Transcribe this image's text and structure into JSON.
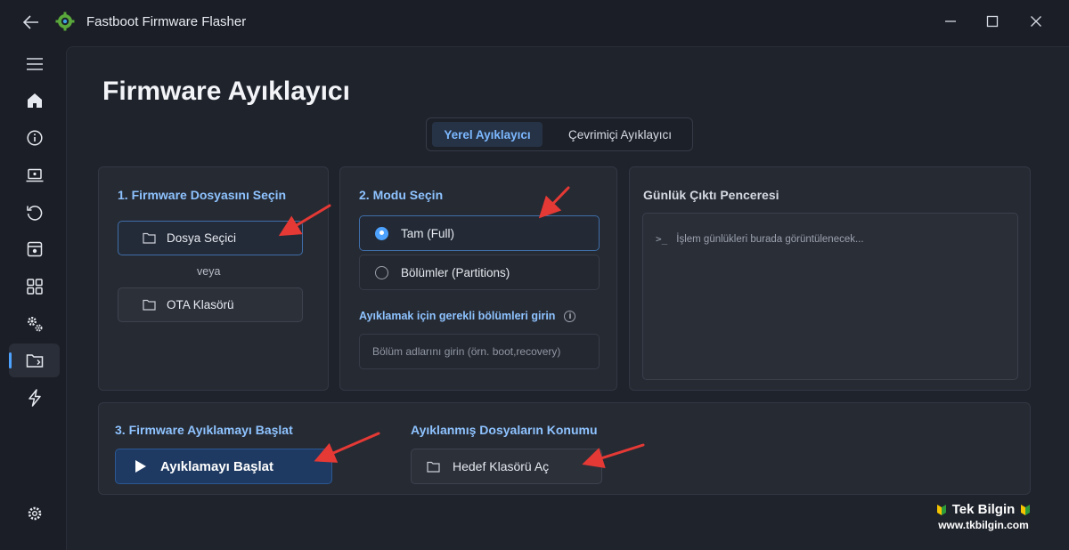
{
  "window": {
    "title": "Fastboot Firmware Flasher"
  },
  "page": {
    "title": "Firmware Ayıklayıcı",
    "tabs": [
      {
        "label": "Yerel Ayıklayıcı",
        "active": true
      },
      {
        "label": "Çevrimiçi Ayıklayıcı",
        "active": false
      }
    ]
  },
  "sidebar": {
    "items": [
      {
        "icon": "menu-icon"
      },
      {
        "icon": "home-icon"
      },
      {
        "icon": "info-icon"
      },
      {
        "icon": "laptop-icon"
      },
      {
        "icon": "restore-icon"
      },
      {
        "icon": "archive-icon"
      },
      {
        "icon": "apps-grid-icon"
      },
      {
        "icon": "gears-icon"
      },
      {
        "icon": "folder-extract-icon",
        "active": true
      },
      {
        "icon": "flash-icon"
      },
      {
        "icon": "settings-icon"
      }
    ]
  },
  "step1": {
    "title": "1. Firmware Dosyasını Seçin",
    "file_picker_label": "Dosya Seçici",
    "or_label": "veya",
    "ota_label": "OTA Klasörü"
  },
  "step2": {
    "title": "2. Modu Seçin",
    "options": [
      {
        "label": "Tam (Full)",
        "selected": true
      },
      {
        "label": "Bölümler (Partitions)",
        "selected": false
      }
    ],
    "partitions_label": "Ayıklamak için gerekli bölümleri girin",
    "partitions_placeholder": "Bölüm adlarını girin (örn. boot,recovery)"
  },
  "log": {
    "title": "Günlük Çıktı Penceresi",
    "prompt": ">_",
    "placeholder": "İşlem günlükleri burada görüntülenecek..."
  },
  "step3": {
    "title": "3. Firmware Ayıklamayı Başlat",
    "start_label": "Ayıklamayı Başlat"
  },
  "output": {
    "title": "Ayıklanmış Dosyaların Konumu",
    "open_label": "Hedef Klasörü Aç"
  },
  "watermark": {
    "name": "Tek Bilgin",
    "url": "www.tkbilgin.com"
  },
  "colors": {
    "accent": "#4ea2ff",
    "heading": "#8ec3ff",
    "annotation_arrow": "#e53935"
  }
}
